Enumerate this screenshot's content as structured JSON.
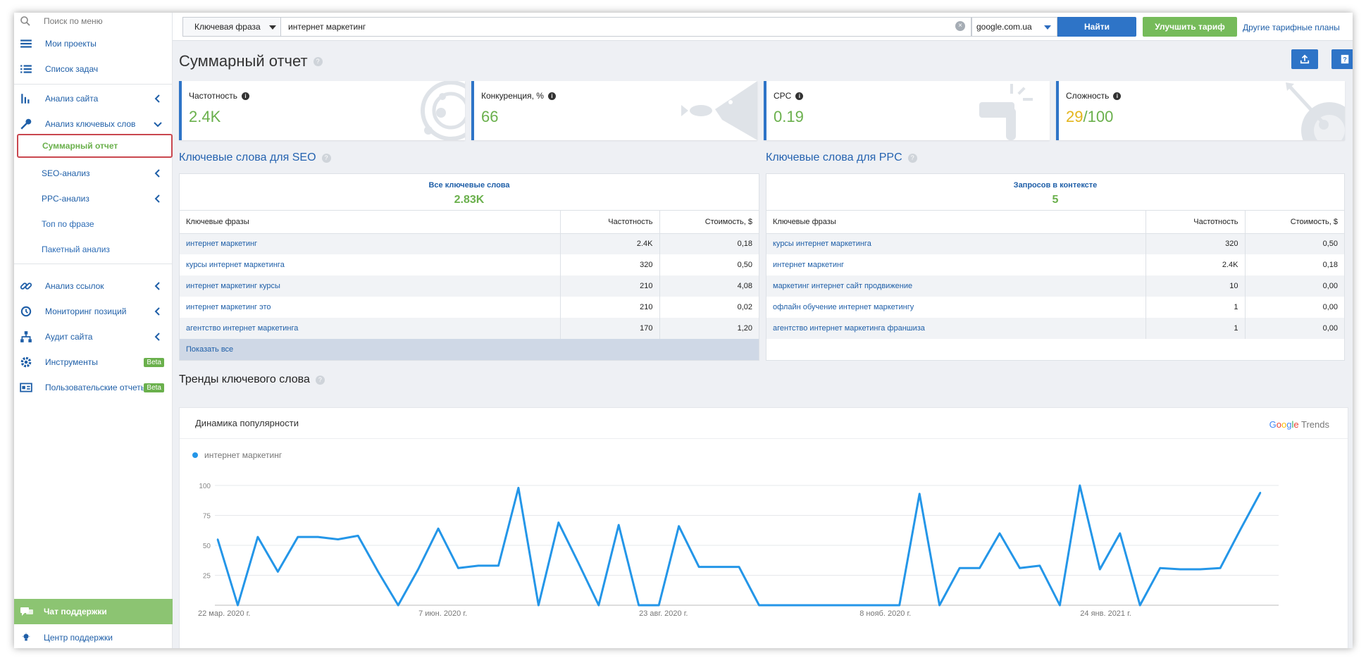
{
  "sidebar": {
    "search_placeholder": "Поиск по меню",
    "my_projects": "Мои проекты",
    "task_list": "Список задач",
    "site_analysis": "Анализ сайта",
    "keyword_analysis": "Анализ ключевых слов",
    "summary_report": "Суммарный отчет",
    "seo_analysis": "SEO-анализ",
    "ppc_analysis": "PPC-анализ",
    "top_by_phrase": "Топ по фразе",
    "batch_analysis": "Пакетный анализ",
    "link_analysis": "Анализ ссылок",
    "position_monitoring": "Мониторинг позиций",
    "site_audit": "Аудит сайта",
    "tools": "Инструменты",
    "user_reports": "Пользовательские отчеты",
    "beta": "Beta",
    "support_chat": "Чат поддержки",
    "help_center": "Центр поддержки"
  },
  "topbar": {
    "search_type": "Ключевая фраза",
    "query": "интернет маркетинг",
    "domain": "google.com.ua",
    "find": "Найти",
    "upgrade": "Улучшить тариф",
    "other_plans": "Другие тарифные планы"
  },
  "page": {
    "title": "Суммарный отчет"
  },
  "metrics": {
    "frequency": {
      "label": "Частотность",
      "value": "2.4K"
    },
    "competition": {
      "label": "Конкуренция, %",
      "value": "66"
    },
    "cpc": {
      "label": "CPC",
      "value": "0.19"
    },
    "difficulty": {
      "label": "Сложность",
      "value_main": "29",
      "value_rest": "/100"
    }
  },
  "seo": {
    "title": "Ключевые слова для SEO",
    "summary_label": "Все ключевые слова",
    "summary_value": "2.83K",
    "columns": [
      "Ключевые фразы",
      "Частотность",
      "Стоимость, $"
    ],
    "rows": [
      [
        "интернет маркетинг",
        "2.4K",
        "0,18"
      ],
      [
        "курсы интернет маркетинга",
        "320",
        "0,50"
      ],
      [
        "интернет маркетинг курсы",
        "210",
        "4,08"
      ],
      [
        "интернет маркетинг это",
        "210",
        "0,02"
      ],
      [
        "агентство интернет маркетинга",
        "170",
        "1,20"
      ]
    ],
    "show_all": "Показать все"
  },
  "ppc": {
    "title": "Ключевые слова для PPC",
    "summary_label": "Запросов в контексте",
    "summary_value": "5",
    "columns": [
      "Ключевые фразы",
      "Частотность",
      "Стоимость, $"
    ],
    "rows": [
      [
        "курсы интернет маркетинга",
        "320",
        "0,50"
      ],
      [
        "интернет маркетинг",
        "2.4K",
        "0,18"
      ],
      [
        "маркетинг интернет сайт продвижение",
        "10",
        "0,00"
      ],
      [
        "офлайн обучение интернет маркетингу",
        "1",
        "0,00"
      ],
      [
        "агентство интернет маркетинга франшиза",
        "1",
        "0,00"
      ]
    ]
  },
  "trends": {
    "title": "Тренды ключевого слова",
    "chart_title": "Динамика популярности",
    "brand": "Google Trends"
  },
  "chart_data": {
    "type": "line",
    "series": [
      {
        "name": "интернет маркетинг",
        "color": "#2496e8",
        "values": [
          55,
          0,
          57,
          28,
          57,
          57,
          55,
          58,
          28,
          0,
          30,
          64,
          31,
          33,
          33,
          98,
          0,
          69,
          35,
          0,
          67,
          0,
          0,
          66,
          32,
          32,
          32,
          0,
          0,
          0,
          0,
          0,
          0,
          0,
          0,
          93,
          0,
          31,
          31,
          60,
          31,
          33,
          0,
          100,
          30,
          60,
          0,
          31,
          30,
          30,
          31,
          63,
          94
        ]
      }
    ],
    "x_tick_labels": [
      "22 мар. 2020 г.",
      "7 июн. 2020 г.",
      "23 авг. 2020 г.",
      "8 нояб. 2020 г.",
      "24 янв. 2021 г."
    ],
    "x_tick_index": [
      0,
      11,
      22,
      33,
      44
    ],
    "y_ticks": [
      25,
      50,
      75,
      100
    ],
    "ylim": [
      0,
      100
    ],
    "grid": true,
    "legend": "top-left"
  }
}
